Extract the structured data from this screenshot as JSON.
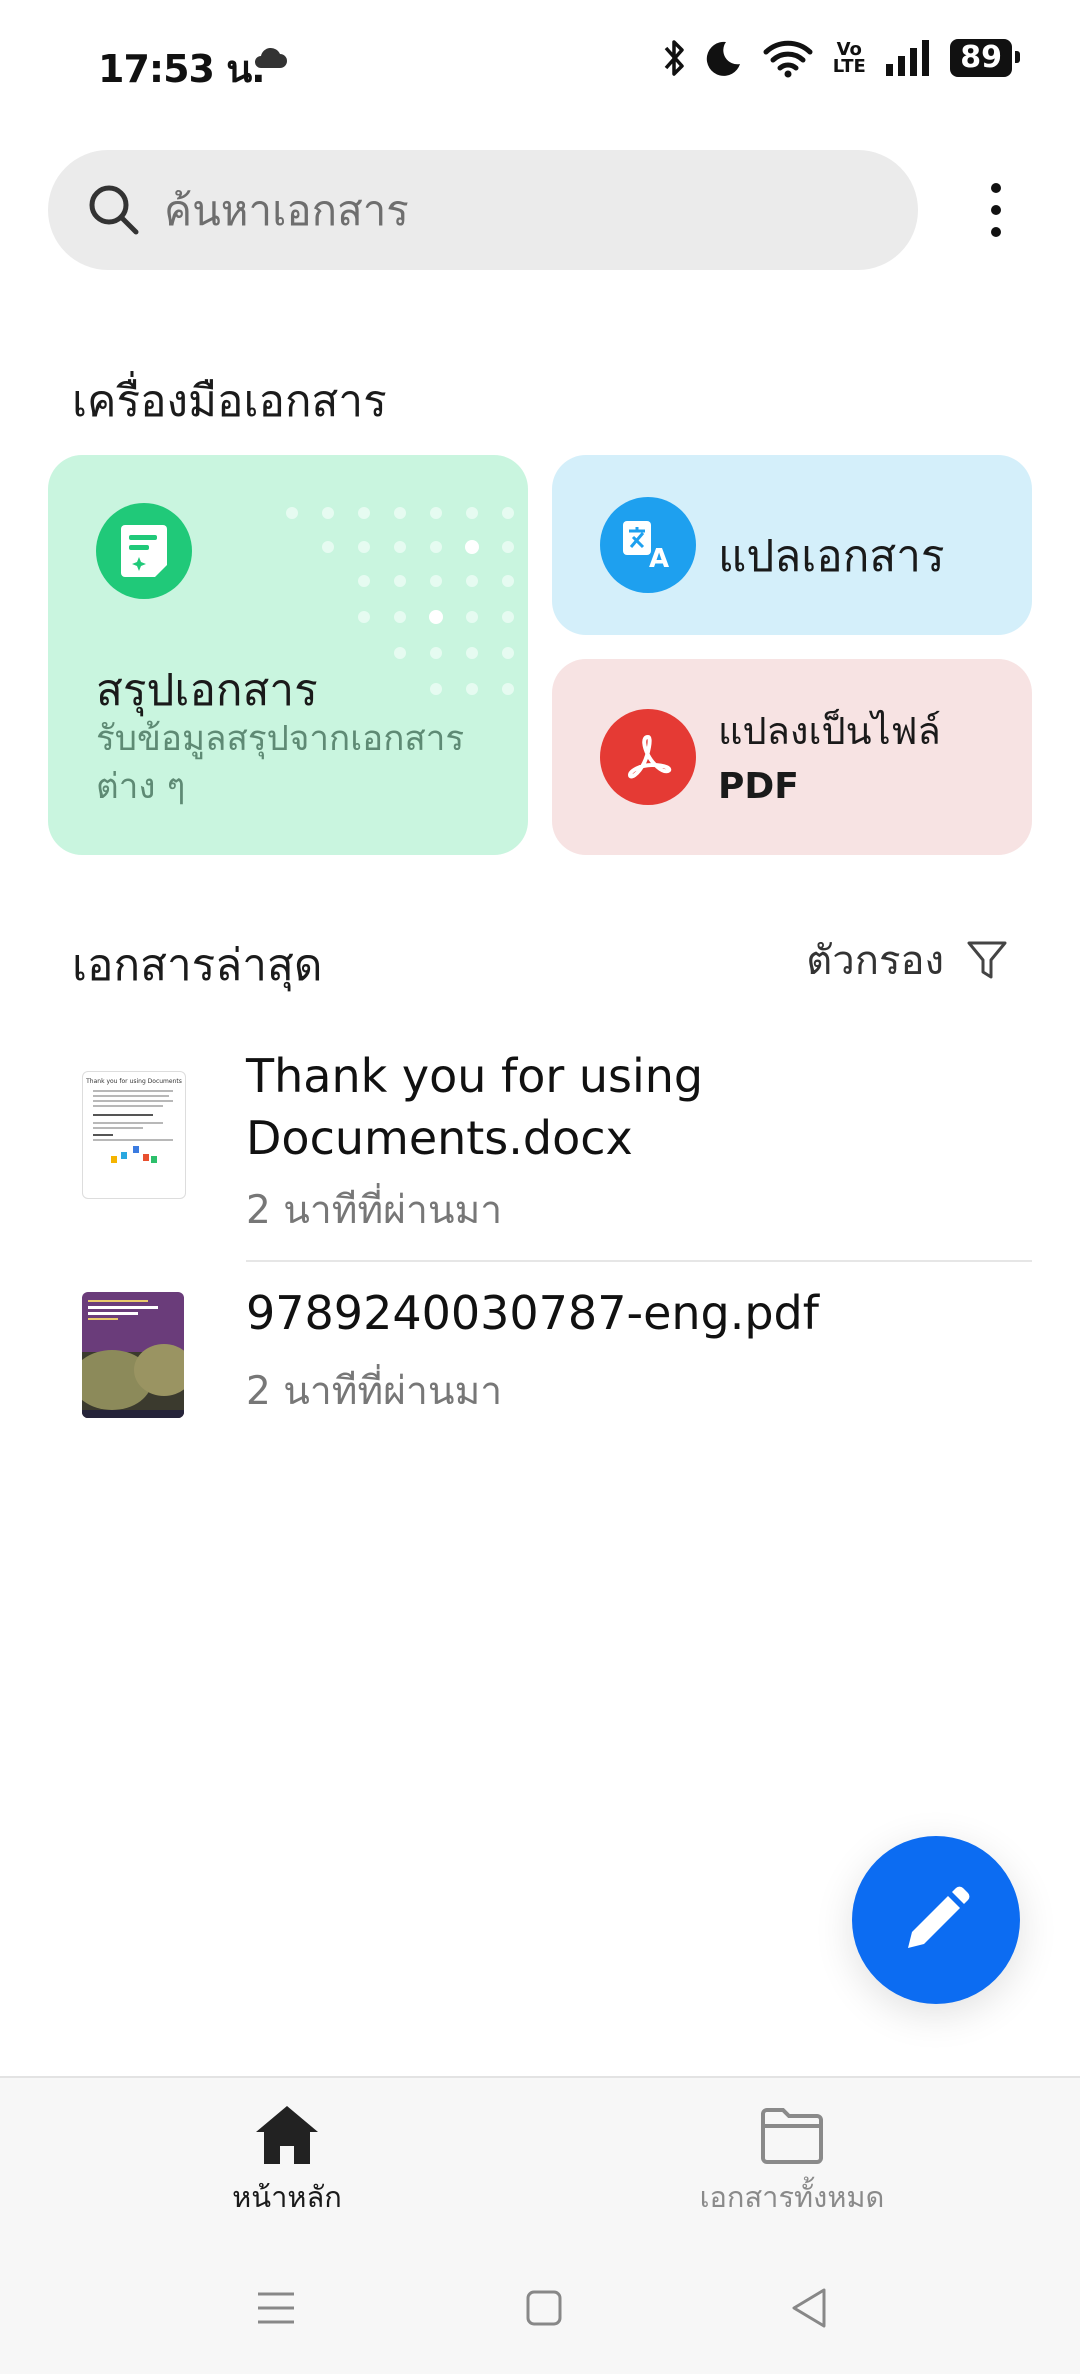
{
  "status_bar": {
    "time": "17:53 น.",
    "battery": "89",
    "network": "Vo LTE"
  },
  "search": {
    "placeholder": "ค้นหาเอกสาร"
  },
  "tools": {
    "title": "เครื่องมือเอกสาร",
    "summary": {
      "title": "สรุปเอกสาร",
      "description": "รับข้อมูลสรุปจากเอกสารต่าง ๆ"
    },
    "translate": {
      "label": "แปลเอกสาร"
    },
    "convert_pdf": {
      "label_line1": "แปลงเป็นไฟล์",
      "label_line2": "PDF"
    }
  },
  "recent": {
    "title": "เอกสารล่าสุด",
    "filter_label": "ตัวกรอง",
    "documents": [
      {
        "name": "Thank you for using Documents.docx",
        "time": "2 นาทีที่ผ่านมา",
        "thumb_title": "Thank you for using Documents"
      },
      {
        "name": "9789240030787-eng.pdf",
        "time": "2 นาทีที่ผ่านมา"
      }
    ]
  },
  "bottom_nav": {
    "home": "หน้าหลัก",
    "all_docs": "เอกสารทั้งหมด"
  },
  "colors": {
    "accent": "#0c6cf2",
    "summary_card": "#c9f5df",
    "translate_card": "#d4effa",
    "pdf_card": "#f7e3e3"
  }
}
